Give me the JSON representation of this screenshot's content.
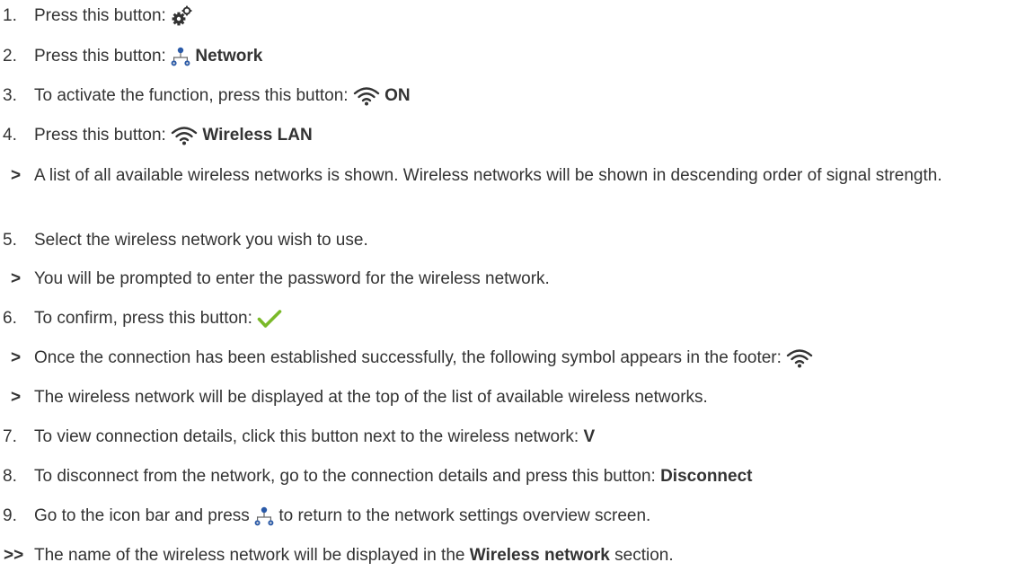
{
  "steps": [
    {
      "marker": "1.",
      "text_before": "Press this button: ",
      "icon": "gears-icon"
    },
    {
      "marker": "2.",
      "text_before": "Press this button: ",
      "icon": "network-icon",
      "bold": "Network"
    },
    {
      "marker": "3.",
      "text_before": "To activate the function, press this button: ",
      "icon": "wifi-icon",
      "bold": "ON"
    },
    {
      "marker": "4.",
      "text_before": "Press this button: ",
      "icon": "wifi-icon",
      "bold": "Wireless LAN"
    },
    {
      "marker": ">",
      "text_before": "A list of all available wireless networks is shown. Wireless networks will be shown in descending order of signal strength."
    },
    {
      "marker": "5.",
      "text_before": "Select the wireless network you wish to use."
    },
    {
      "marker": ">",
      "text_before": "You will be prompted to enter the password for the wireless network."
    },
    {
      "marker": "6.",
      "text_before": "To confirm, press this button: ",
      "icon": "checkmark-icon"
    },
    {
      "marker": ">",
      "text_before": "Once the connection has been established successfully, the following symbol appears in the footer: ",
      "icon": "wifi-icon"
    },
    {
      "marker": ">",
      "text_before": "The wireless network will be displayed at the top of the list of available wireless networks."
    },
    {
      "marker": "7.",
      "text_before": "To view connection details, click this button next to the wireless network: ",
      "bold": "V"
    },
    {
      "marker": "8.",
      "text_before": "To disconnect from the network, go to the connection details and press this button: ",
      "bold": "Disconnect"
    },
    {
      "marker": "9.",
      "text_before": "Go to the icon bar and press ",
      "icon": "network-icon",
      "text_after": " to return to the network settings overview screen."
    },
    {
      "marker": ">>",
      "text_before": "The name of the wireless network will be displayed in the ",
      "bold": "Wireless network",
      "text_after": " section."
    }
  ],
  "colors": {
    "text": "#333333",
    "icon": "#333333",
    "check": "#7ab929",
    "network_node": "#2a5aa8"
  }
}
